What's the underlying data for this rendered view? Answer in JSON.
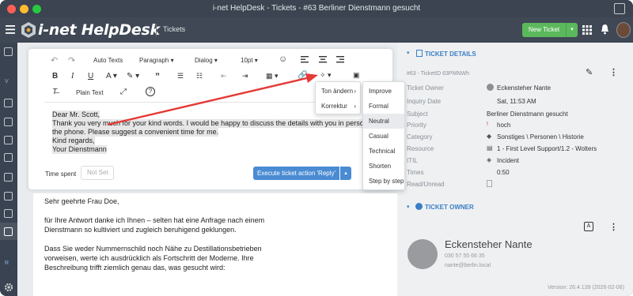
{
  "window": {
    "title": "i-net HelpDesk - Tickets - #63 Berliner Dienstmann gesucht"
  },
  "header": {
    "logo": "i-net HelpDesk",
    "breadcrumb": "Tickets",
    "new_ticket_label": "New Ticket"
  },
  "toolbar": {
    "auto_texts": "Auto Texts",
    "paragraph": "Paragraph",
    "dialog": "Dialog",
    "font_size": "10pt",
    "plain_text": "Plain Text"
  },
  "editor": {
    "lines": [
      "Dear Mr. Scott,",
      "Thank you very much for your kind words. I would be happy to discuss the details with you in person or o",
      "the phone. Please suggest a convenient time for me.",
      "Kind regards,",
      "Your Dienstmann"
    ],
    "time_spent_label": "Time spent",
    "time_spent_placeholder": "Not Set",
    "execute_label": "Execute ticket action 'Reply'"
  },
  "ai_menu": {
    "items": [
      "Ton ändern",
      "Korrektur"
    ],
    "submenu": [
      "Improve",
      "Formal",
      "Neutral",
      "Casual",
      "Technical",
      "Shorten",
      "Step by step"
    ],
    "highlighted": "Neutral"
  },
  "reply_text": [
    "Sehr geehrte Frau Doe,",
    "für Ihre Antwort danke ich Ihnen – selten hat eine Anfrage nach einem",
    "Dienstmann so kultiviert und zugleich beruhigend geklungen.",
    "Dass Sie weder Nummernschild noch Nähe zu Destillationsbetrieben",
    "vorweisen, werte ich ausdrücklich als Fortschritt der Moderne. Ihre",
    "Beschreibung trifft ziemlich genau das, was gesucht wird:"
  ],
  "ticket_details": {
    "heading": "TICKET DETAILS",
    "ticket_id": "#63 - TicketID 63PMNWh",
    "fields": [
      {
        "label": "Ticket Owner",
        "value": "Eckensteher Nante"
      },
      {
        "label": "Inquiry Date",
        "value": "Sat, 11:53 AM"
      },
      {
        "label": "Subject",
        "value": "Berliner Dienstmann gesucht"
      },
      {
        "label": "Priority",
        "value": "hoch"
      },
      {
        "label": "Category",
        "value": "Sonstiges \\ Personen \\ Historie"
      },
      {
        "label": "Resource",
        "value": "1 - First Level Support/1.2 - Wolters"
      },
      {
        "label": "ITIL",
        "value": "Incident"
      },
      {
        "label": "Times",
        "value": "0:50"
      },
      {
        "label": "Read/Unread",
        "value": ""
      }
    ]
  },
  "ticket_owner": {
    "heading": "TICKET OWNER",
    "name": "Eckensteher Nante",
    "phone": "030 57 55 66 35",
    "email": "nante@berlin.local"
  },
  "footer": {
    "version": "Version: 26.4.139 (2026-02-06)"
  },
  "colors": {
    "accent": "#3b7ec7",
    "green": "#5cb85c",
    "header": "#3f4854",
    "arrow": "#e53935"
  }
}
